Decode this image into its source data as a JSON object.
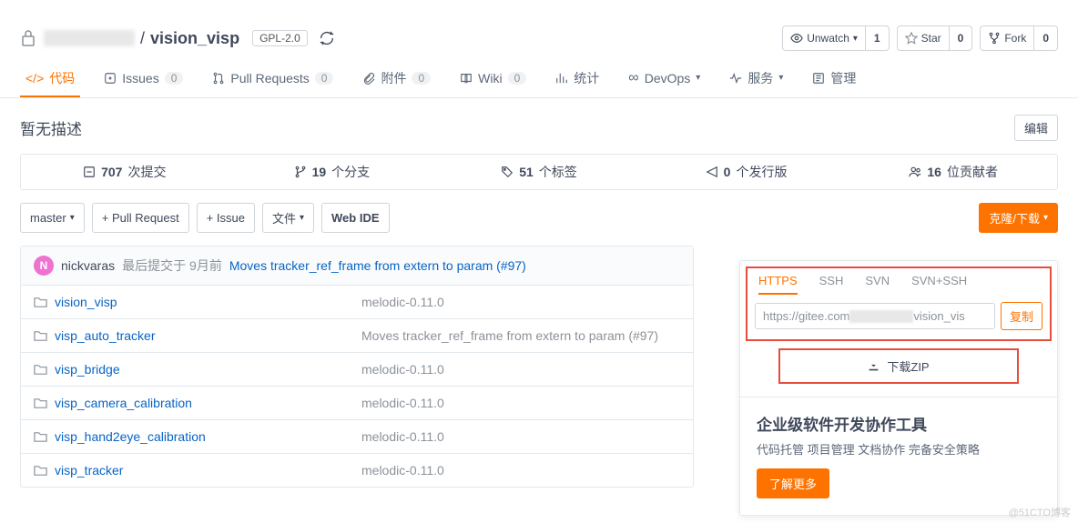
{
  "header": {
    "repo_name": "vision_visp",
    "separator": "/",
    "license": "GPL-2.0",
    "actions": {
      "unwatch": {
        "label": "Unwatch",
        "count": "1"
      },
      "star": {
        "label": "Star",
        "count": "0"
      },
      "fork": {
        "label": "Fork",
        "count": "0"
      }
    }
  },
  "tabs": {
    "code": "代码",
    "issues": {
      "label": "Issues",
      "count": "0"
    },
    "pulls": {
      "label": "Pull Requests",
      "count": "0"
    },
    "attach": {
      "label": "附件",
      "count": "0"
    },
    "wiki": {
      "label": "Wiki",
      "count": "0"
    },
    "stats": "统计",
    "devops": "DevOps",
    "service": "服务",
    "manage": "管理"
  },
  "description": {
    "text": "暂无描述",
    "edit": "编辑"
  },
  "stats_bar": {
    "commits": {
      "count": "707",
      "label": "次提交"
    },
    "branches": {
      "count": "19",
      "label": "个分支"
    },
    "tags": {
      "count": "51",
      "label": "个标签"
    },
    "releases": {
      "count": "0",
      "label": "个发行版"
    },
    "contributors": {
      "count": "16",
      "label": "位贡献者"
    }
  },
  "actions": {
    "branch": "master",
    "new_pr": "+ Pull Request",
    "new_issue": "+ Issue",
    "files": "文件",
    "web_ide": "Web IDE",
    "clone": "克隆/下载"
  },
  "last_commit": {
    "avatar": "N",
    "author": "nickvaras",
    "meta": "最后提交于 9月前",
    "message": "Moves tracker_ref_frame from extern to param (#97)"
  },
  "files": [
    {
      "name": "vision_visp",
      "msg": "melodic-0.11.0"
    },
    {
      "name": "visp_auto_tracker",
      "msg": "Moves tracker_ref_frame from extern to param (#97)"
    },
    {
      "name": "visp_bridge",
      "msg": "melodic-0.11.0"
    },
    {
      "name": "visp_camera_calibration",
      "msg": "melodic-0.11.0"
    },
    {
      "name": "visp_hand2eye_calibration",
      "msg": "melodic-0.11.0"
    },
    {
      "name": "visp_tracker",
      "msg": "melodic-0.11.0"
    }
  ],
  "clone": {
    "tabs": {
      "https": "HTTPS",
      "ssh": "SSH",
      "svn": "SVN",
      "svnssh": "SVN+SSH"
    },
    "url_prefix": "https://gitee.com",
    "url_suffix": "vision_vis",
    "copy": "复制",
    "zip": "下载ZIP"
  },
  "promo": {
    "title": "企业级软件开发协作工具",
    "desc": "代码托管 项目管理 文档协作 完备安全策略",
    "btn": "了解更多"
  },
  "watermark": "@51CTO博客"
}
